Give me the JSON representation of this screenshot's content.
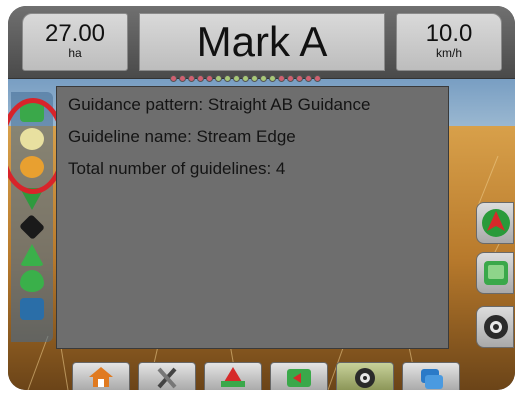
{
  "header": {
    "area_value": "27.00",
    "area_unit": "ha",
    "mark_label": "Mark A",
    "speed_value": "10.0",
    "speed_unit": "km/h"
  },
  "lightbar": {
    "leds": [
      "#d06070",
      "#d06070",
      "#d06070",
      "#d06070",
      "#d06070",
      "#a8c878",
      "#a8c878",
      "#a8c878",
      "#a8c878",
      "#a8c878",
      "#a8c878",
      "#a8c878",
      "#d06070",
      "#d06070",
      "#d06070",
      "#d06070",
      "#d06070"
    ]
  },
  "popup": {
    "guidance_pattern": "Guidance pattern: Straight AB Guidance",
    "guideline_name": "Guideline name: Stream Edge",
    "guideline_count": "Total number of guidelines: 4"
  },
  "left_toolbar": {
    "icons": [
      "guideline-start-icon",
      "guideline-shift-icon",
      "nudge-icon",
      "swath-icon",
      "boundary-icon",
      "marker-icon",
      "product-icon",
      "gnss-icon"
    ]
  },
  "right_toolbar": {
    "icons": [
      "view-nav-icon",
      "pan-icon",
      "camera-icon"
    ]
  },
  "bottom_tabs": {
    "icons": [
      "home-icon",
      "tools-icon",
      "guidance-icon",
      "field-icon",
      "video-icon",
      "data-icon"
    ]
  },
  "colors": {
    "highlight": "#d8242a",
    "popup_bg": "#6e6e6e",
    "lightbar_red": "#d06070",
    "lightbar_green": "#a8c878"
  }
}
